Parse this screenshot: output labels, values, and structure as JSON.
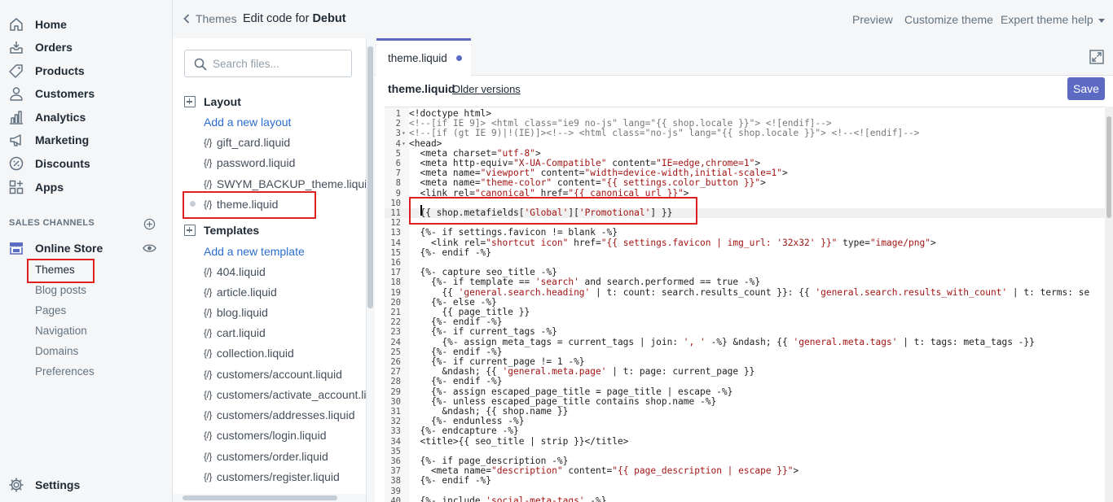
{
  "nav": {
    "items": [
      {
        "label": "Home",
        "icon": "home-icon"
      },
      {
        "label": "Orders",
        "icon": "orders-icon"
      },
      {
        "label": "Products",
        "icon": "tag-icon"
      },
      {
        "label": "Customers",
        "icon": "person-icon"
      },
      {
        "label": "Analytics",
        "icon": "chart-icon"
      },
      {
        "label": "Marketing",
        "icon": "megaphone-icon"
      },
      {
        "label": "Discounts",
        "icon": "discount-icon"
      },
      {
        "label": "Apps",
        "icon": "apps-icon"
      }
    ],
    "sales_channels_heading": "SALES CHANNELS",
    "online_store": "Online Store",
    "sub_items": [
      "Themes",
      "Blog posts",
      "Pages",
      "Navigation",
      "Domains",
      "Preferences"
    ],
    "settings": "Settings"
  },
  "topbar": {
    "back_label": "Themes",
    "title_prefix": "Edit code for",
    "theme_name": "Debut",
    "preview": "Preview",
    "customize": "Customize theme",
    "help": "Expert theme help"
  },
  "files": {
    "search_placeholder": "Search files...",
    "layout_heading": "Layout",
    "add_layout": "Add a new layout",
    "layout_files": [
      "gift_card.liquid",
      "password.liquid",
      "SWYM_BACKUP_theme.liquid",
      "theme.liquid"
    ],
    "templates_heading": "Templates",
    "add_template": "Add a new template",
    "template_files": [
      "404.liquid",
      "article.liquid",
      "blog.liquid",
      "cart.liquid",
      "collection.liquid",
      "customers/account.liquid",
      "customers/activate_account.liquid",
      "customers/addresses.liquid",
      "customers/login.liquid",
      "customers/order.liquid",
      "customers/register.liquid"
    ],
    "file_icon_glyph": "{/}"
  },
  "editor": {
    "tab_label": "theme.liquid",
    "file_name": "theme.liquid",
    "older_versions": "Older versions",
    "save_label": "Save"
  },
  "code_lines": [
    "<!doctype html>",
    "<!--[if IE 9]> <html class=\"ie9 no-js\" lang=\"{{ shop.locale }}\"> <![endif]-->",
    "<!--[if (gt IE 9)|!(IE)]><!--> <html class=\"no-js\" lang=\"{{ shop.locale }}\"> <!--<![endif]-->",
    "<head>",
    "  <meta charset=\"utf-8\">",
    "  <meta http-equiv=\"X-UA-Compatible\" content=\"IE=edge,chrome=1\">",
    "  <meta name=\"viewport\" content=\"width=device-width,initial-scale=1\">",
    "  <meta name=\"theme-color\" content=\"{{ settings.color_button }}\">",
    "  <link rel=\"canonical\" href=\"{{ canonical_url }}\">",
    "",
    "  {{ shop.metafields['Global']['Promotional'] }}",
    "",
    "  {%- if settings.favicon != blank -%}",
    "    <link rel=\"shortcut icon\" href=\"{{ settings.favicon | img_url: '32x32' }}\" type=\"image/png\">",
    "  {%- endif -%}",
    "",
    "  {%- capture seo_title -%}",
    "    {%- if template == 'search' and search.performed == true -%}",
    "      {{ 'general.search.heading' | t: count: search.results_count }}: {{ 'general.search.results_with_count' | t: terms: se",
    "    {%- else -%}",
    "      {{ page_title }}",
    "    {%- endif -%}",
    "    {%- if current_tags -%}",
    "      {%- assign meta_tags = current_tags | join: ', ' -%} &ndash; {{ 'general.meta.tags' | t: tags: meta_tags -}}",
    "    {%- endif -%}",
    "    {%- if current_page != 1 -%}",
    "      &ndash; {{ 'general.meta.page' | t: page: current_page }}",
    "    {%- endif -%}",
    "    {%- assign escaped_page_title = page_title | escape -%}",
    "    {%- unless escaped_page_title contains shop.name -%}",
    "      &ndash; {{ shop.name }}",
    "    {%- endunless -%}",
    "  {%- endcapture -%}",
    "  <title>{{ seo_title | strip }}</title>",
    "",
    "  {%- if page_description -%}",
    "    <meta name=\"description\" content=\"{{ page_description | escape }}\">",
    "  {%- endif -%}",
    "",
    "  {%- include 'social-meta-tags' -%}"
  ],
  "colors": {
    "accent": "#5c6ac4",
    "link": "#2b6cd1",
    "highlight_box": "#e02020"
  }
}
